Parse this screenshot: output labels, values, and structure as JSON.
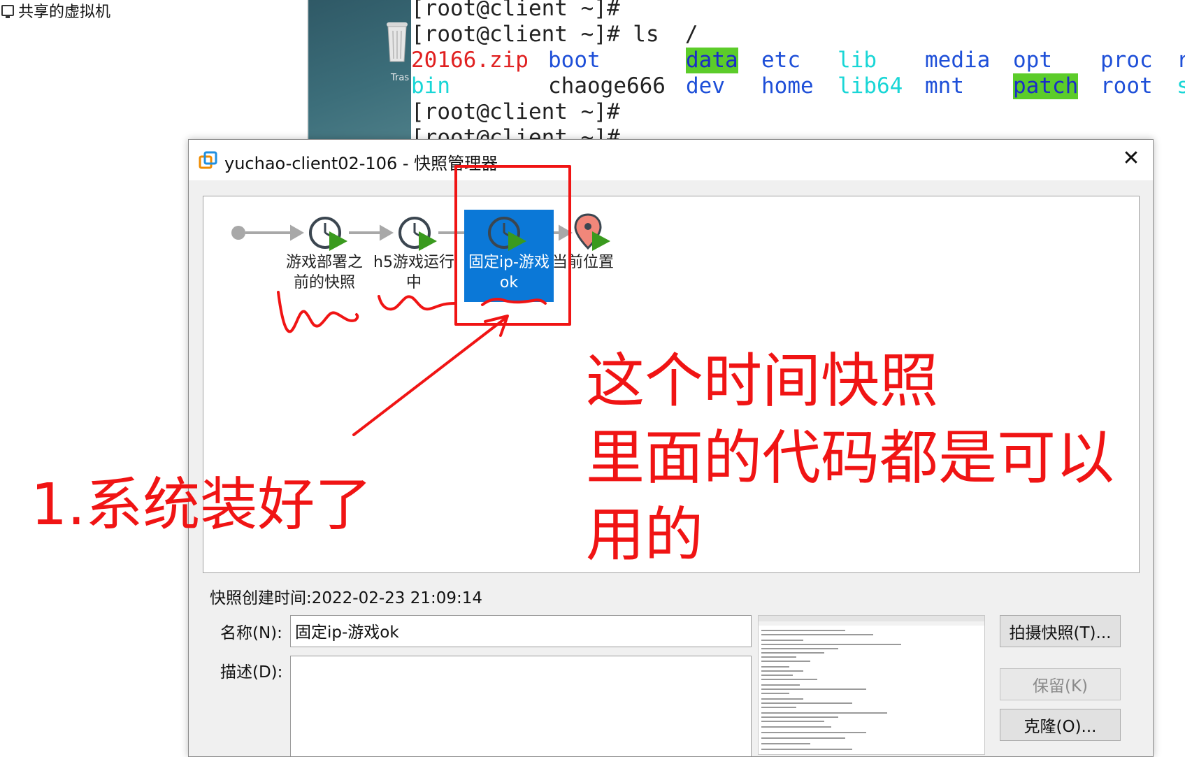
{
  "sidebar": {
    "item_label": "共享的虚拟机"
  },
  "desktop": {
    "trash_label": "Tras"
  },
  "terminal": {
    "line1": "[root@client ~]#",
    "line2": "[root@client ~]# ls  /",
    "row3": [
      "20166.zip",
      "boot",
      "data",
      "etc",
      "lib",
      "media",
      "opt",
      "proc",
      "r"
    ],
    "row4": [
      "bin",
      "chaoge666",
      "dev",
      "home",
      "lib64",
      "mnt",
      "patch",
      "root",
      "s"
    ],
    "line5": "[root@client ~]#",
    "line6": "[root@client ~]#"
  },
  "dialog": {
    "title": "yuchao-client02-106 - 快照管理器",
    "close_glyph": "✕",
    "snapshots": [
      {
        "line1": "游戏部署之",
        "line2": "前的快照"
      },
      {
        "line1": "h5游戏运行",
        "line2": "中"
      },
      {
        "line1": "固定ip-游戏",
        "line2": "ok"
      },
      {
        "line1": "当前位置",
        "line2": ""
      }
    ],
    "created_time": "快照创建时间:2022-02-23 21:09:14",
    "name_label": "名称(N):",
    "name_value": "固定ip-游戏ok",
    "desc_label": "描述(D):",
    "buttons": {
      "take": "拍摄快照(T)...",
      "keep": "保留(K)",
      "clone": "克隆(O)..."
    }
  },
  "annotations": {
    "note_left": "1.系统装好了",
    "note_right_line1": "这个时间快照",
    "note_right_line2": "里面的代码都是可以",
    "note_right_line3": "用的"
  },
  "colors": {
    "annotation": "#f01414",
    "selection": "#0b78d7",
    "play_arrow": "#3a9a1e",
    "terminal_highlight": "#5ccc2a"
  }
}
